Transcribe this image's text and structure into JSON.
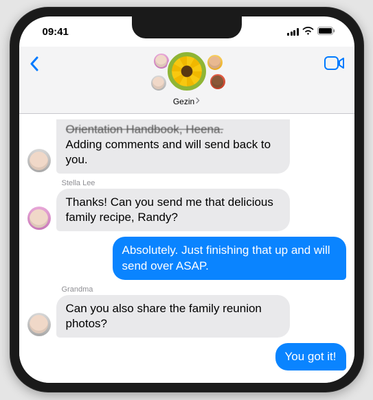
{
  "status": {
    "time": "09:41"
  },
  "nav": {
    "group_name": "Gezin"
  },
  "messages": {
    "m0": {
      "line1": "Orientation Handbook, Heena.",
      "line2": "Adding comments and will send back to you."
    },
    "m1": {
      "sender": "Stella Lee",
      "text": "Thanks! Can you send me that delicious family recipe, Randy?"
    },
    "m2": {
      "text": "Absolutely. Just finishing that up and will send over ASAP."
    },
    "m3": {
      "sender": "Grandma",
      "text": "Can you also share the family reunion photos?"
    },
    "m4": {
      "text": "You got it!"
    }
  }
}
